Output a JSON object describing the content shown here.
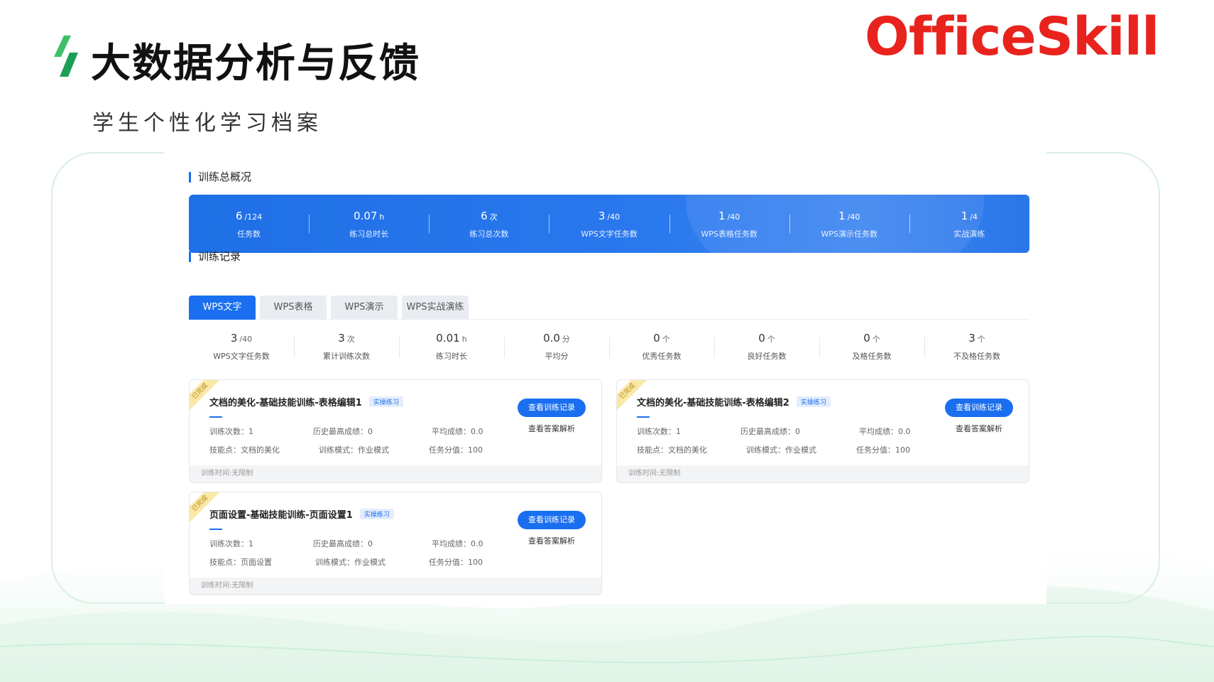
{
  "slide": {
    "title": "大数据分析与反馈",
    "subtitle": "学生个性化学习档案",
    "logo_text": "OfficeSkill",
    "brand_color": "#e8231d",
    "accent_color": "#1a6ff0"
  },
  "overview": {
    "section_title": "训练总概况",
    "items": [
      {
        "value": "6",
        "unit": "/124",
        "label": "任务数"
      },
      {
        "value": "0.07",
        "unit": "h",
        "label": "练习总时长"
      },
      {
        "value": "6",
        "unit": "次",
        "label": "练习总次数"
      },
      {
        "value": "3",
        "unit": "/40",
        "label": "WPS文字任务数"
      },
      {
        "value": "1",
        "unit": "/40",
        "label": "WPS表格任务数"
      },
      {
        "value": "1",
        "unit": "/40",
        "label": "WPS演示任务数"
      },
      {
        "value": "1",
        "unit": "/4",
        "label": "实战演练"
      }
    ]
  },
  "records": {
    "section_title": "训练记录",
    "tabs": [
      {
        "label": "WPS文字",
        "active": true
      },
      {
        "label": "WPS表格",
        "active": false
      },
      {
        "label": "WPS演示",
        "active": false
      },
      {
        "label": "WPS实战演练",
        "active": false
      }
    ],
    "stats": [
      {
        "value": "3",
        "unit": "/40",
        "label": "WPS文字任务数"
      },
      {
        "value": "3",
        "unit": "次",
        "label": "累计训练次数"
      },
      {
        "value": "0.01",
        "unit": "h",
        "label": "练习时长"
      },
      {
        "value": "0.0",
        "unit": "分",
        "label": "平均分"
      },
      {
        "value": "0",
        "unit": "个",
        "label": "优秀任务数"
      },
      {
        "value": "0",
        "unit": "个",
        "label": "良好任务数"
      },
      {
        "value": "0",
        "unit": "个",
        "label": "及格任务数"
      },
      {
        "value": "3",
        "unit": "个",
        "label": "不及格任务数"
      }
    ],
    "cards": [
      {
        "ribbon": "已完成",
        "title": "文档的美化-基础技能训练-表格编辑1",
        "tag": "实操练习",
        "train_count": "训练次数：1",
        "best_score": "历史最高成绩：0",
        "avg_score": "平均成绩：0.0",
        "skill": "技能点：文档的美化",
        "mode": "训练模式：作业模式",
        "task_score": "任务分值：100",
        "primary_button": "查看训练记录",
        "link_button": "查看答案解析",
        "footer": "训练时间:无限制"
      },
      {
        "ribbon": "已完成",
        "title": "文档的美化-基础技能训练-表格编辑2",
        "tag": "实操练习",
        "train_count": "训练次数：1",
        "best_score": "历史最高成绩：0",
        "avg_score": "平均成绩：0.0",
        "skill": "技能点：文档的美化",
        "mode": "训练模式：作业模式",
        "task_score": "任务分值：100",
        "primary_button": "查看训练记录",
        "link_button": "查看答案解析",
        "footer": "训练时间:无限制"
      },
      {
        "ribbon": "已完成",
        "title": "页面设置-基础技能训练-页面设置1",
        "tag": "实操练习",
        "train_count": "训练次数：1",
        "best_score": "历史最高成绩：0",
        "avg_score": "平均成绩：0.0",
        "skill": "技能点：页面设置",
        "mode": "训练模式：作业模式",
        "task_score": "任务分值：100",
        "primary_button": "查看训练记录",
        "link_button": "查看答案解析",
        "footer": "训练时间:无限制"
      }
    ]
  }
}
